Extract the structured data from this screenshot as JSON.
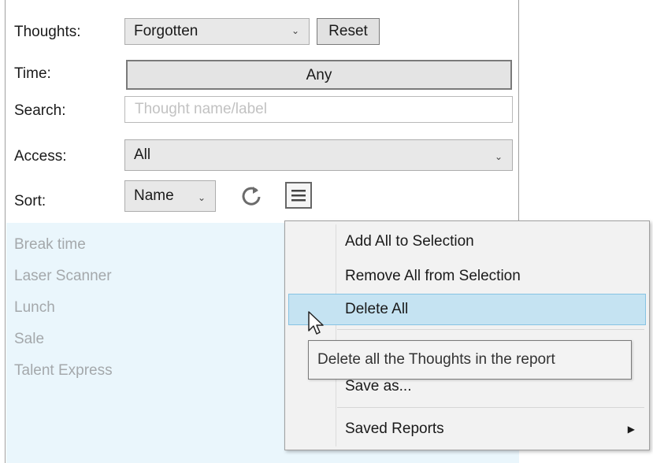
{
  "filters": {
    "thoughts_label": "Thoughts:",
    "thoughts_value": "Forgotten",
    "reset_label": "Reset",
    "time_label": "Time:",
    "time_value": "Any",
    "search_label": "Search:",
    "search_placeholder": "Thought name/label",
    "access_label": "Access:",
    "access_value": "All",
    "sort_label": "Sort:",
    "sort_value": "Name"
  },
  "list": {
    "items": [
      "Break time",
      "Laser Scanner",
      "Lunch",
      "Sale",
      "Talent Express"
    ]
  },
  "context_menu": {
    "items": [
      {
        "label": "Add All to Selection"
      },
      {
        "label": "Remove All from Selection"
      },
      {
        "label": "Delete All",
        "highlighted": true
      },
      {
        "label": "Save as..."
      },
      {
        "label": "Saved Reports",
        "has_submenu": true
      }
    ]
  },
  "tooltip": {
    "text": "Delete all the Thoughts in the report"
  },
  "colors": {
    "list_bg": "#eaf6fc",
    "highlight_bg": "#c5e3f2",
    "highlight_border": "#86c3e3"
  }
}
